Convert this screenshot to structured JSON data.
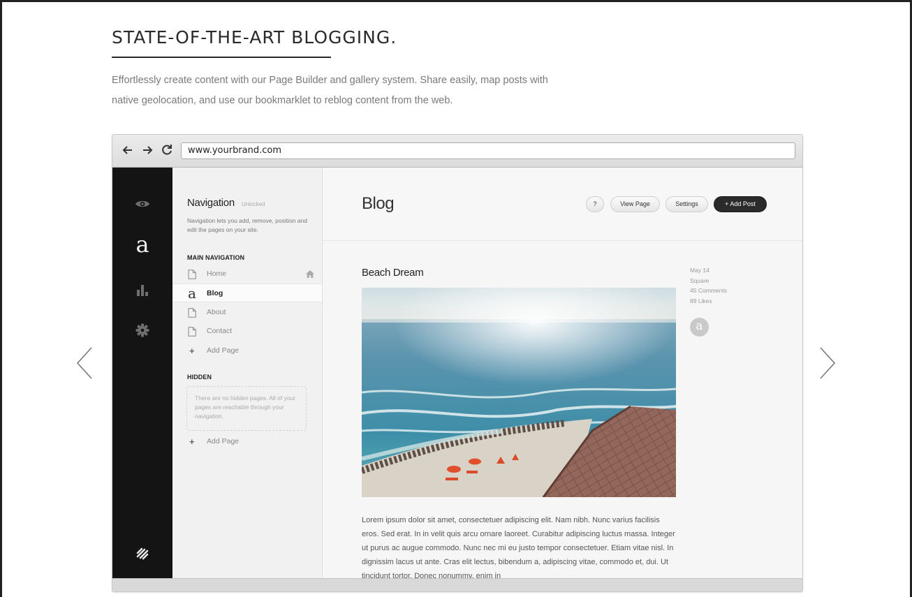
{
  "hero": {
    "title": "STATE-OF-THE-ART BLOGGING.",
    "description": "Effortlessly create content with our Page Builder and gallery system. Share easily, map posts with native geolocation, and use our bookmarklet to reblog content from the web."
  },
  "browser": {
    "url": "www.yourbrand.com"
  },
  "rail": {
    "logo_letter": "a"
  },
  "nav_panel": {
    "title": "Navigation",
    "lock_status": "Unlocked",
    "description": "Navigation lets you add, remove, position and edit the pages on your site.",
    "main_heading": "MAIN NAVIGATION",
    "items": [
      {
        "label": "Home"
      },
      {
        "label": "Blog",
        "icon_letter": "a"
      },
      {
        "label": "About"
      },
      {
        "label": "Contact"
      }
    ],
    "add_page_label": "Add Page",
    "hidden_heading": "HIDDEN",
    "hidden_empty_text": "There are no hidden pages. All of your pages are reachable through your navigation.",
    "hidden_add_page_label": "Add Page"
  },
  "content": {
    "page_title": "Blog",
    "buttons": {
      "help": "?",
      "view_page": "View Page",
      "settings": "Settings",
      "add_post": "+ Add Post"
    },
    "post": {
      "title": "Beach Dream",
      "meta": {
        "date": "May 14",
        "author": "Square",
        "comments": "45 Comments",
        "likes": "89 Likes"
      },
      "avatar_letter": "a",
      "body": "Lorem ipsum dolor sit amet, consectetuer adipiscing elit. Nam nibh. Nunc varius facilisis eros. Sed erat. In in velit quis arcu ornare laoreet. Curabitur adipiscing luctus massa. Integer ut purus ac augue commodo. Nunc nec mi eu justo tempor consectetuer. Etiam vitae nisl. In dignissim lacus ut ante. Cras elit lectus, bibendum a, adipiscing vitae, commodo et, dui. Ut tincidunt tortor. Donec nonummy, enim in"
    }
  }
}
